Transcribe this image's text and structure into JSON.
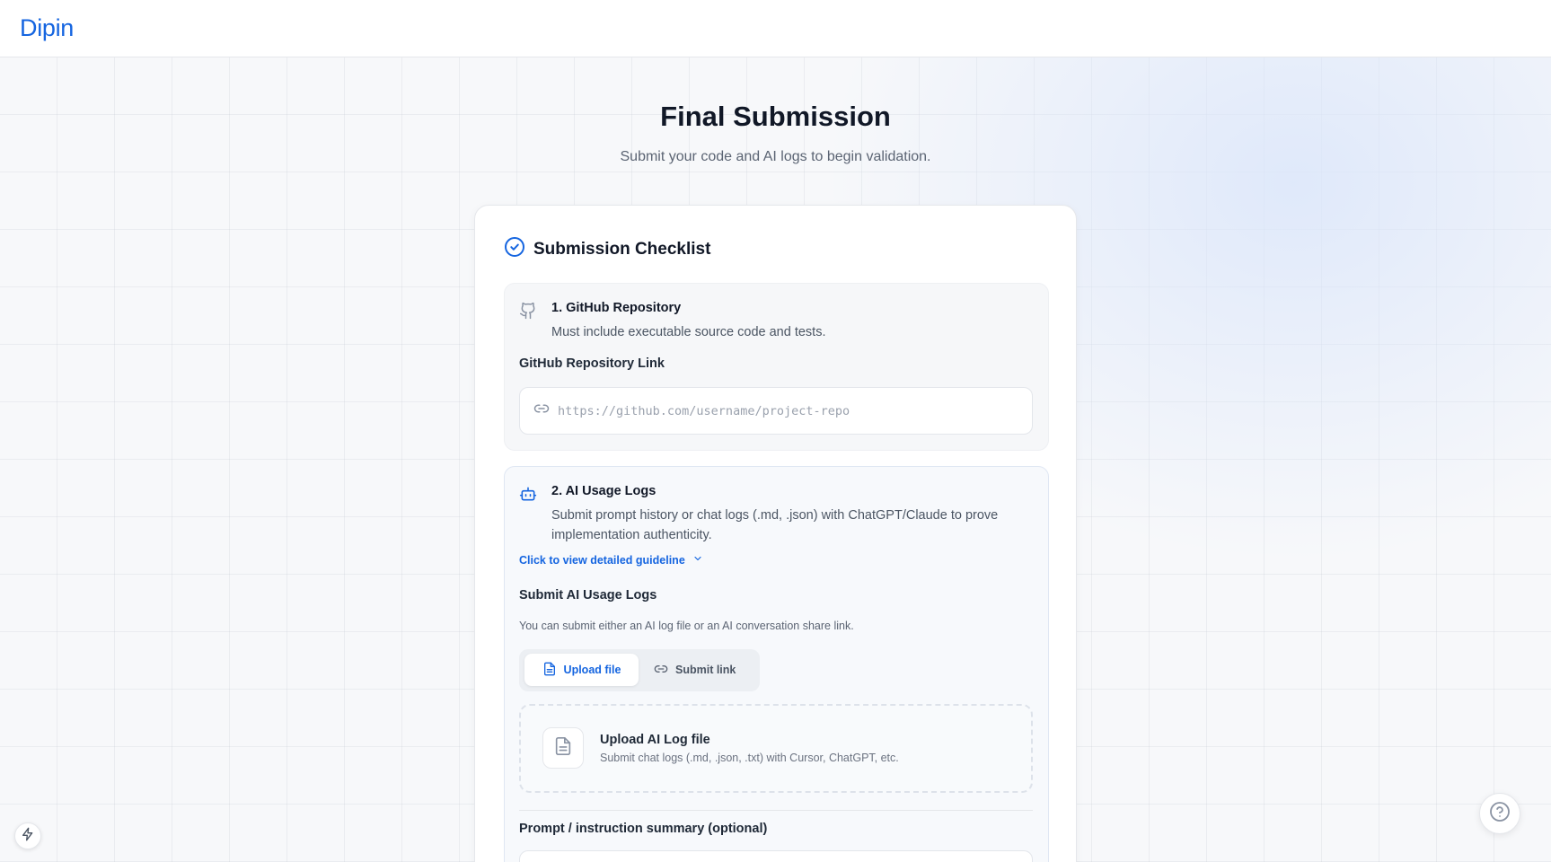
{
  "header": {
    "logo": "Dipin"
  },
  "page": {
    "title": "Final Submission",
    "subtitle": "Submit your code and AI logs to begin validation."
  },
  "checklist": {
    "title": "Submission Checklist",
    "icon": "check-circle-icon",
    "accent_color": "#1565e0"
  },
  "github_section": {
    "title": "1. GitHub Repository",
    "description": "Must include executable source code and tests.",
    "field_label": "GitHub Repository Link",
    "input_value": "",
    "input_placeholder": "https://github.com/username/project-repo",
    "icon": "github-icon",
    "input_icon": "link-icon"
  },
  "ai_logs_section": {
    "title": "2. AI Usage Logs",
    "description": "Submit prompt history or chat logs (.md, .json) with ChatGPT/Claude to prove implementation authenticity.",
    "guideline_link": "Click to view detailed guideline",
    "submit_label": "Submit AI Usage Logs",
    "helper_text": "You can submit either an AI log file or an AI conversation share link.",
    "tabs": [
      {
        "label": "Upload file",
        "icon": "file-icon",
        "active": true
      },
      {
        "label": "Submit link",
        "icon": "link-icon",
        "active": false
      }
    ],
    "upload": {
      "title": "Upload AI Log file",
      "subtitle": "Submit chat logs (.md, .json, .txt) with Cursor, ChatGPT, etc."
    },
    "prompt_label": "Prompt / instruction summary (optional)",
    "icon": "robot-icon"
  },
  "floating": {
    "left_icon": "lightning-icon",
    "help_icon": "help-circle-icon"
  }
}
